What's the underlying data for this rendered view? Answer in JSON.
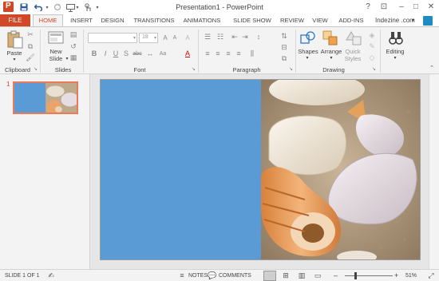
{
  "titlebar": {
    "title": "Presentation1 - PowerPoint",
    "help_icon": "?",
    "ribbon_options_icon": "⊡",
    "minimize_icon": "–",
    "maximize_icon": "□",
    "close_icon": "✕"
  },
  "tabs": [
    "FILE",
    "HOME",
    "INSERT",
    "DESIGN",
    "TRANSITIONS",
    "ANIMATIONS",
    "SLIDE SHOW",
    "REVIEW",
    "VIEW",
    "ADD-INS"
  ],
  "active_tab": "HOME",
  "user": {
    "name": "Indezine .com"
  },
  "ribbon": {
    "clipboard": {
      "label": "Clipboard",
      "paste": "Paste"
    },
    "slides": {
      "label": "Slides",
      "new_slide_line1": "New",
      "new_slide_line2": "Slide"
    },
    "font": {
      "label": "Font",
      "size": "18",
      "bold": "B",
      "italic": "I",
      "underline": "U",
      "shadow": "S",
      "strike": "abc",
      "grow": "A",
      "shrink": "A",
      "clear": "A",
      "color": "A",
      "change_case": "Aa"
    },
    "paragraph": {
      "label": "Paragraph"
    },
    "drawing": {
      "label": "Drawing",
      "shapes": "Shapes",
      "arrange": "Arrange",
      "quick_styles_1": "Quick",
      "quick_styles_2": "Styles"
    },
    "editing": {
      "label": "Editing"
    }
  },
  "thumbnails": [
    {
      "number": "1"
    }
  ],
  "statusbar": {
    "slide_info": "SLIDE 1 OF 1",
    "notes": "NOTES",
    "comments": "COMMENTS",
    "zoom_minus": "–",
    "zoom_plus": "+",
    "zoom": "51%"
  },
  "colors": {
    "accent": "#d24726",
    "slide_blue": "#5b9bd5",
    "ribbon_bg": "#f3f3f3"
  }
}
